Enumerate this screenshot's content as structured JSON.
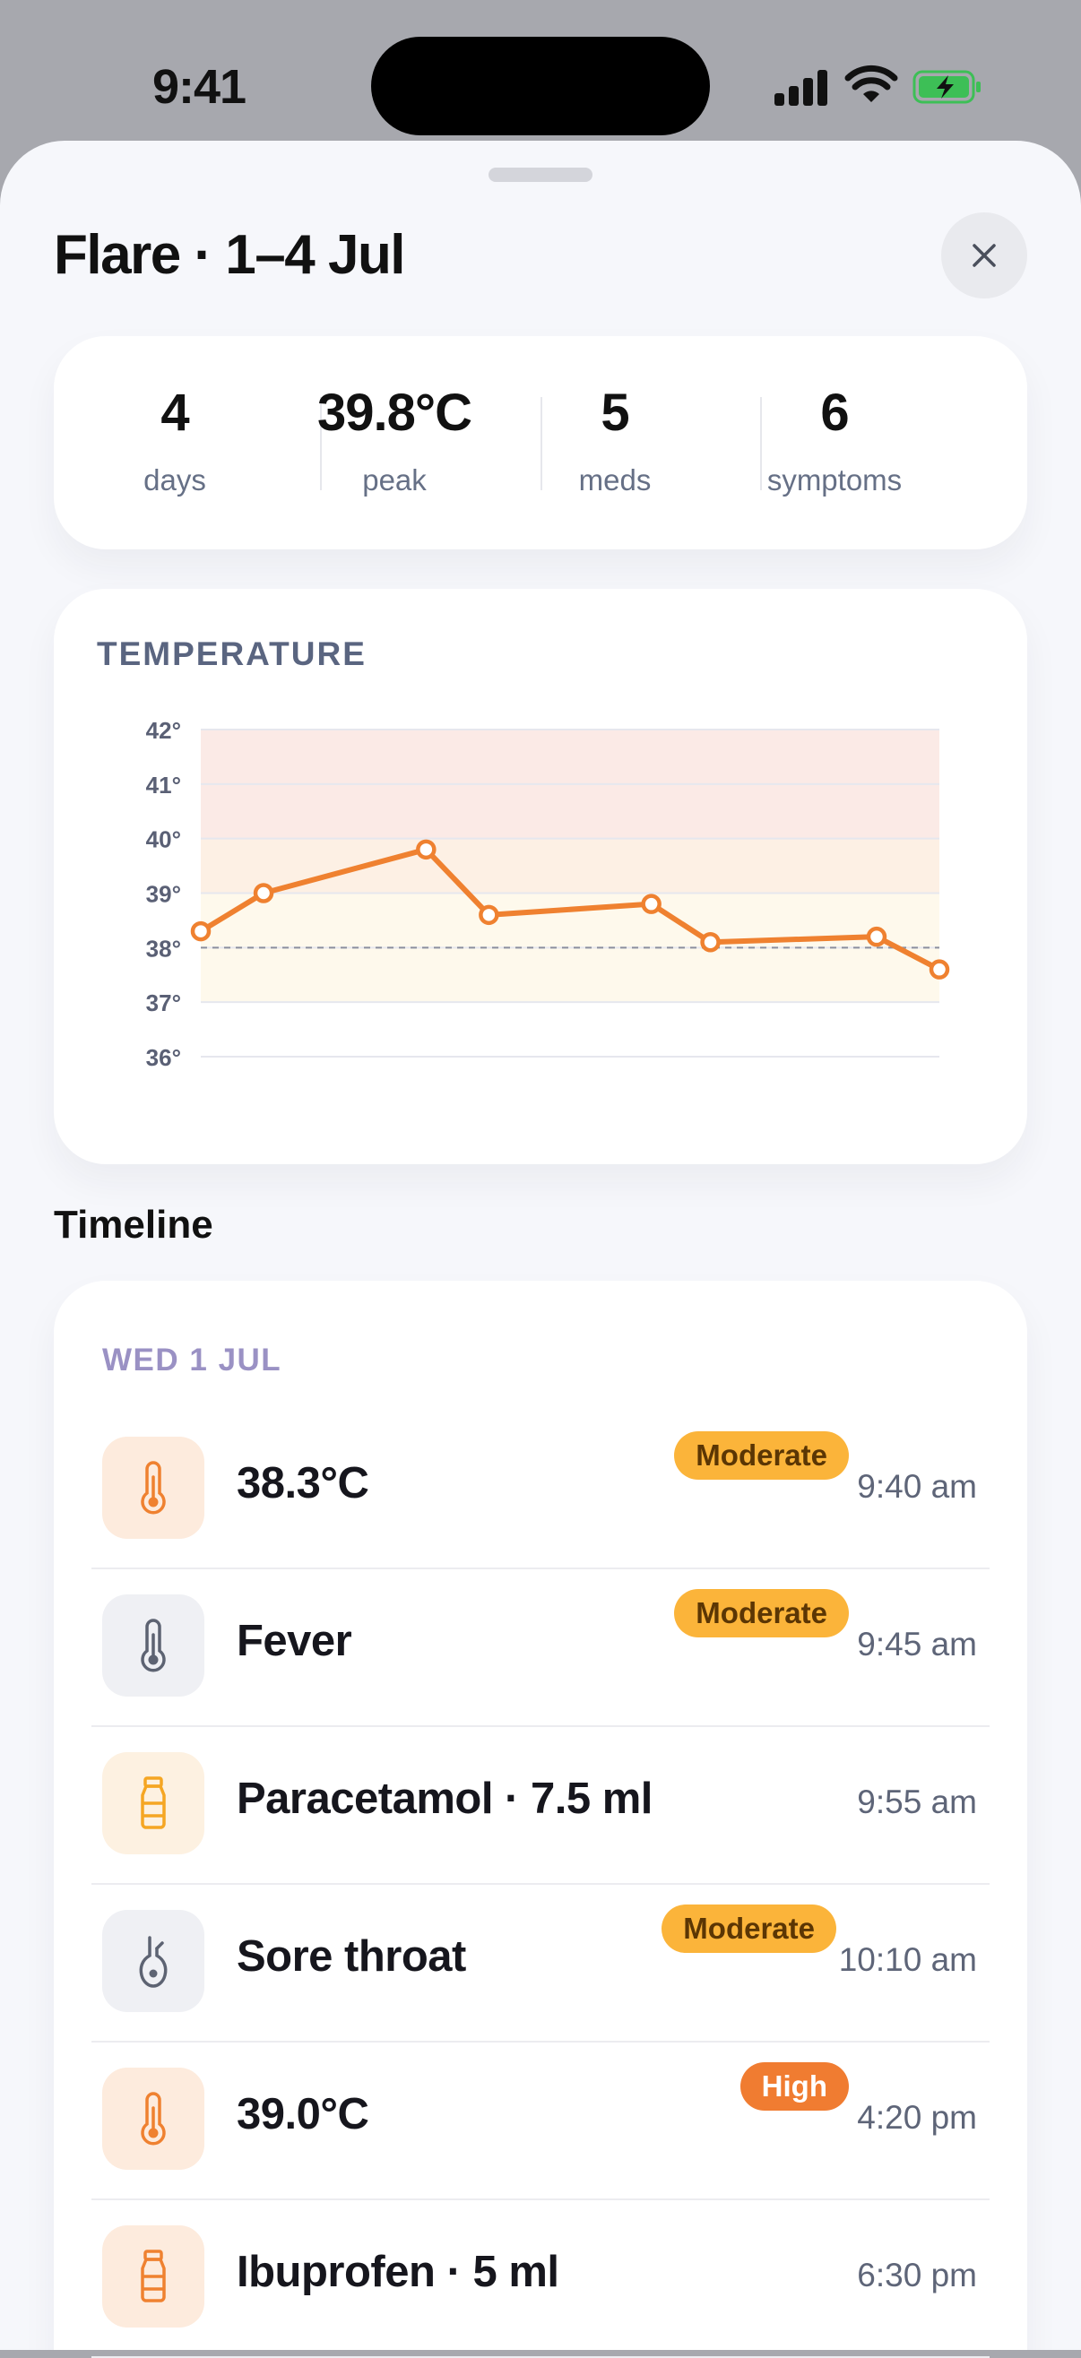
{
  "status_bar": {
    "time": "9:41"
  },
  "sheet": {
    "title": "Flare · 1–4 Jul"
  },
  "stats": [
    {
      "value": "4",
      "label": "days"
    },
    {
      "value": "39.8°C",
      "label": "peak"
    },
    {
      "value": "5",
      "label": "meds"
    },
    {
      "value": "6",
      "label": "symptoms"
    }
  ],
  "chart": {
    "heading": "TEMPERATURE"
  },
  "chart_data": {
    "type": "line",
    "title": "TEMPERATURE",
    "xlabel": "",
    "ylabel": "",
    "ylim": [
      36,
      42
    ],
    "y_ticks": [
      "42°",
      "41°",
      "40°",
      "39°",
      "38°",
      "37°",
      "36°"
    ],
    "threshold": 38,
    "series": [
      {
        "x": [
          0,
          0.085,
          0.305,
          0.39,
          0.61,
          0.69,
          0.915,
          1.0
        ],
        "values": [
          38.3,
          39.0,
          39.8,
          38.6,
          38.8,
          38.1,
          38.2,
          37.6
        ]
      }
    ],
    "colors": {
      "line": "#ef8130",
      "band_high": "#fbeae6",
      "band_mid": "#fdf0e4",
      "band_low": "#fef9ec"
    }
  },
  "timeline": {
    "title": "Timeline",
    "day": "WED 1 JUL",
    "entries": [
      {
        "icon": "thermometer-icon",
        "title": "38.3°C",
        "time": "9:40 am",
        "badge": "Moderate",
        "level": "moderate",
        "tint": "peach"
      },
      {
        "icon": "thermometer-icon",
        "title": "Fever",
        "time": "9:45 am",
        "badge": "Moderate",
        "level": "moderate",
        "tint": "grey"
      },
      {
        "icon": "medicine-bottle-icon",
        "title": "Paracetamol · 7.5 ml",
        "time": "9:55 am",
        "badge": "",
        "level": "",
        "tint": "cream"
      },
      {
        "icon": "throat-icon",
        "title": "Sore throat",
        "time": "10:10 am",
        "badge": "Moderate",
        "level": "moderate",
        "tint": "grey"
      },
      {
        "icon": "thermometer-icon",
        "title": "39.0°C",
        "time": "4:20 pm",
        "badge": "High",
        "level": "high",
        "tint": "peach"
      },
      {
        "icon": "medicine-bottle-icon",
        "title": "Ibuprofen · 5 ml",
        "time": "6:30 pm",
        "badge": "",
        "level": "",
        "tint": "peach"
      }
    ]
  }
}
